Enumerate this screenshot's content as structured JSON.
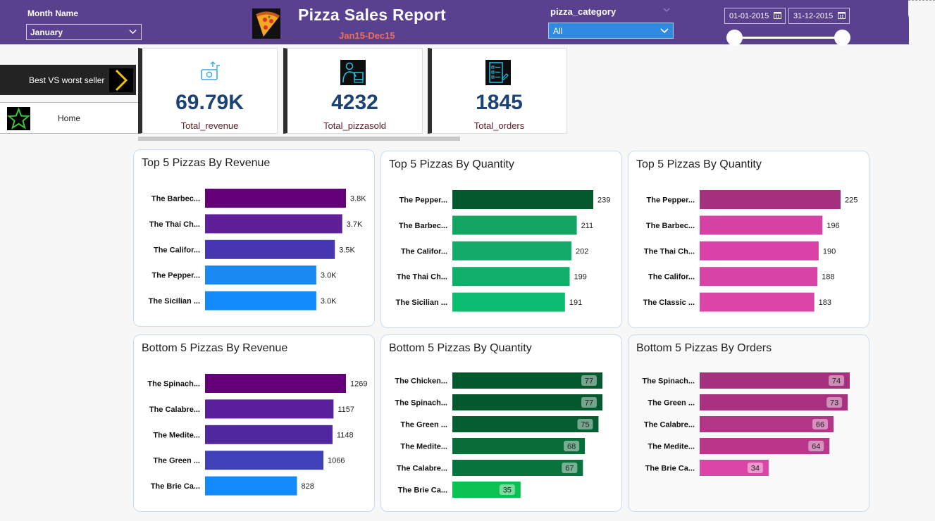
{
  "header": {
    "title": "Pizza Sales Report",
    "subtitle": "Jan15-Dec15",
    "month_label": "Month Name",
    "month_value": "January",
    "category_label": "pizza_category",
    "category_value": "All",
    "date_start": "01-01-2015",
    "date_end": "31-12-2015"
  },
  "nav": {
    "best_worst": "Best VS worst seller",
    "home": "Home"
  },
  "kpis": [
    {
      "value": "69.79K",
      "label": "Total_revenue",
      "icon": "money-transfer-icon"
    },
    {
      "value": "4232",
      "label": "Total_pizzasold",
      "icon": "delivery-person-icon"
    },
    {
      "value": "1845",
      "label": "Total_orders",
      "icon": "order-list-icon"
    }
  ],
  "colors": {
    "header": "#59418f",
    "kpi_value": "#1d4373",
    "kpi_label": "#5b2026"
  },
  "chart_data": [
    {
      "type": "bar",
      "title": "Top 5 Pizzas By Revenue",
      "categories": [
        "The Barbec...",
        "The Thai Ch...",
        "The Califor...",
        "The Pepper...",
        "The Sicilian ..."
      ],
      "values": [
        3.8,
        3.7,
        3.5,
        3.0,
        3.0
      ],
      "labels": [
        "3.8K",
        "3.7K",
        "3.5K",
        "3.0K",
        "3.0K"
      ],
      "colors": [
        "#640078",
        "#5e1f98",
        "#4636b2",
        "#1a8af0",
        "#138bfb"
      ],
      "label_style": "outside",
      "orientation": "horizontal"
    },
    {
      "type": "bar",
      "title": "Top 5 Pizzas By Quantity",
      "categories": [
        "The Pepper...",
        "The Barbec...",
        "The Califor...",
        "The Thai Ch...",
        "The Sicilian ..."
      ],
      "values": [
        239,
        211,
        202,
        199,
        191
      ],
      "labels": [
        "239",
        "211",
        "202",
        "199",
        "191"
      ],
      "colors": [
        "#04582e",
        "#14a563",
        "#13ab69",
        "#10b06b",
        "#0bbd71"
      ],
      "label_style": "outside",
      "orientation": "horizontal"
    },
    {
      "type": "bar",
      "title": "Top 5 Pizzas By Quantity",
      "categories": [
        "The Pepper...",
        "The Barbec...",
        "The Thai Ch...",
        "The Califor...",
        "The Classic ..."
      ],
      "values": [
        225,
        196,
        190,
        188,
        183
      ],
      "labels": [
        "225",
        "196",
        "190",
        "188",
        "183"
      ],
      "colors": [
        "#a5307d",
        "#d542a4",
        "#d842a6",
        "#d843a6",
        "#dc45a8"
      ],
      "label_style": "outside",
      "orientation": "horizontal"
    },
    {
      "type": "bar",
      "title": "Bottom 5 Pizzas By Revenue",
      "categories": [
        "The Spinach...",
        "The Calabre...",
        "The Medite...",
        "The Green ...",
        "The Brie Ca..."
      ],
      "values": [
        1269,
        1157,
        1148,
        1066,
        828
      ],
      "labels": [
        "1269",
        "1157",
        "1148",
        "1066",
        "828"
      ],
      "colors": [
        "#640078",
        "#5a209b",
        "#50279f",
        "#4040b8",
        "#138bfb"
      ],
      "label_style": "outside",
      "orientation": "horizontal"
    },
    {
      "type": "bar",
      "title": "Bottom 5 Pizzas By Quantity",
      "categories": [
        "The Chicken...",
        "The Spinach...",
        "The Green ...",
        "The Medite...",
        "The Calabre...",
        "The Brie Ca..."
      ],
      "values": [
        77,
        77,
        75,
        68,
        67,
        35
      ],
      "labels": [
        "77",
        "77",
        "75",
        "68",
        "67",
        "35"
      ],
      "colors": [
        "#04582e",
        "#04582e",
        "#055e31",
        "#076e39",
        "#08733c",
        "#0bc152"
      ],
      "label_style": "inside",
      "orientation": "horizontal"
    },
    {
      "type": "bar",
      "title": "Bottom 5 Pizzas By Orders",
      "categories": [
        "The Spinach...",
        "The Green ...",
        "The Calabre...",
        "The Medite...",
        "The Brie Ca..."
      ],
      "values": [
        74,
        73,
        66,
        64,
        34
      ],
      "labels": [
        "74",
        "73",
        "66",
        "64",
        "34"
      ],
      "colors": [
        "#a5307d",
        "#a8307f",
        "#b33588",
        "#b8378b",
        "#dc45a8"
      ],
      "label_style": "inside",
      "orientation": "horizontal"
    }
  ]
}
